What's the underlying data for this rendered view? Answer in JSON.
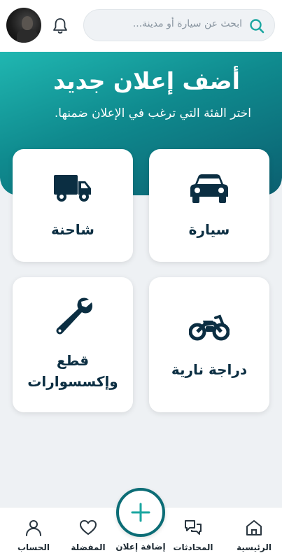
{
  "header": {
    "search_placeholder": "ابحث عن سيارة أو مدينة...",
    "icons": {
      "search": "search-icon",
      "notifications": "bell-icon",
      "avatar": "user-avatar"
    }
  },
  "hero": {
    "title": "أضف إعلان جديد",
    "subtitle": "اختر الفئة التي ترغب في الإعلان ضمنها."
  },
  "categories": [
    {
      "label": "سيارة",
      "icon": "car-icon"
    },
    {
      "label": "شاحنة",
      "icon": "truck-icon"
    },
    {
      "label": "دراجة نارية",
      "icon": "motorcycle-icon"
    },
    {
      "label_line1": "قطع",
      "label_line2": "وإكسسوارات",
      "icon": "wrench-icon"
    }
  ],
  "bottom_nav": {
    "items": [
      {
        "label": "الرئيسية",
        "icon": "home-icon"
      },
      {
        "label": "المحادثات",
        "icon": "chat-icon"
      },
      {
        "label": "إضافة إعلان",
        "icon": "plus-icon"
      },
      {
        "label": "المفضلة",
        "icon": "heart-icon"
      },
      {
        "label": "الحساب",
        "icon": "user-icon"
      }
    ]
  },
  "colors": {
    "accent": "#0c6d76",
    "hero_start": "#20b7b1",
    "hero_end": "#0b5f70",
    "icon_dark": "#0b2e42",
    "search_icon": "#1aa6a0"
  }
}
